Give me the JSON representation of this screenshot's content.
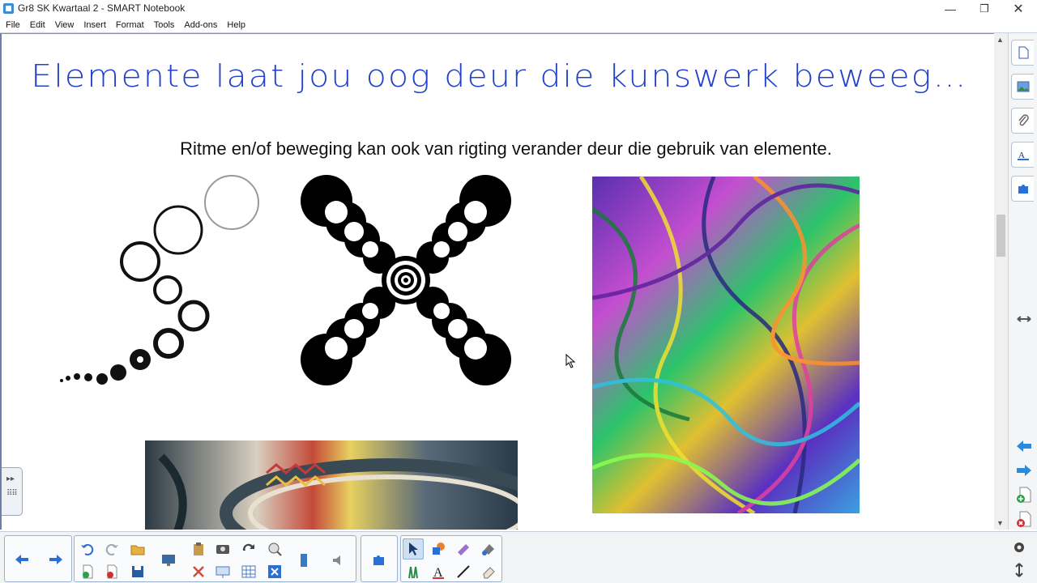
{
  "window": {
    "title": "Gr8 SK Kwartaal 2 - SMART Notebook",
    "controls": {
      "minimize": "—",
      "restore": "❐",
      "close": "✕"
    }
  },
  "menu": {
    "items": [
      "File",
      "Edit",
      "View",
      "Insert",
      "Format",
      "Tools",
      "Add-ons",
      "Help"
    ]
  },
  "page": {
    "title": "Elemente laat jou oog deur die kunswerk beweeg…",
    "subtitle": "Ritme en/of beweging kan ook van rigting verander deur die gebruik van elemente."
  },
  "colors": {
    "title_blue": "#2140cc",
    "toolbar_blue": "#2a6fd6",
    "accent_orange": "#e8832a"
  },
  "side_panel": {
    "icons": [
      "page-sorter-icon",
      "gallery-icon",
      "attachments-icon",
      "properties-icon",
      "add-ons-icon",
      "move-panel-icon",
      "previous-page-icon",
      "next-page-icon",
      "add-page-icon",
      "delete-page-icon"
    ]
  },
  "toolbar": {
    "icons": [
      "previous-page-icon",
      "next-page-icon",
      "undo-icon",
      "redo-icon",
      "open-icon",
      "screen-shade-icon",
      "paste-icon",
      "capture-icon",
      "full-screen-icon",
      "doc-camera-icon",
      "table-icon",
      "delete-icon",
      "insert-page-icon",
      "save-icon",
      "add-page-icon",
      "audio-icon",
      "add-ons-icon",
      "select-icon",
      "shapes-icon",
      "magic-pen-icon",
      "fill-icon",
      "pens-icon",
      "text-icon",
      "line-icon",
      "eraser-icon",
      "customize-icon",
      "move-toolbar-icon"
    ]
  }
}
